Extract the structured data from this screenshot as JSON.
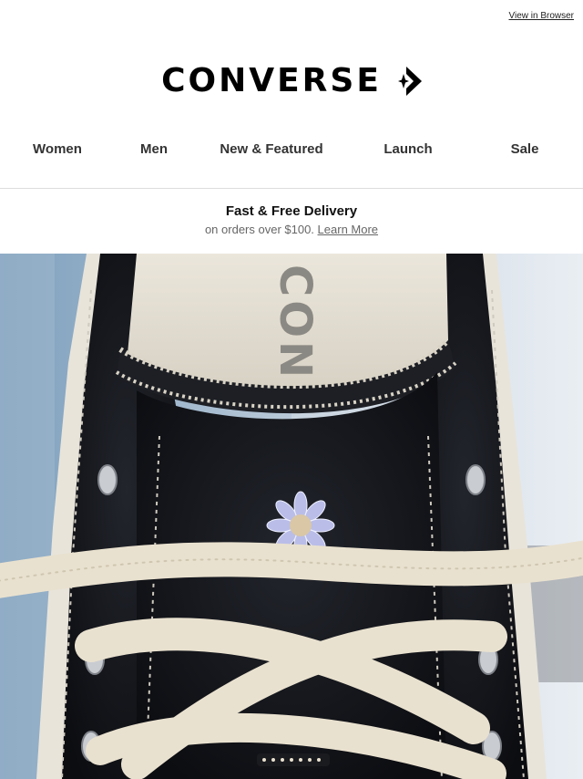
{
  "header": {
    "view_in_browser": "View in Browser"
  },
  "brand": {
    "logo_text": "CONVERSE",
    "logo_icon": "star-chevron-icon"
  },
  "nav": {
    "items": [
      {
        "label": "Women"
      },
      {
        "label": "Men"
      },
      {
        "label": "New & Featured"
      },
      {
        "label": "Launch"
      },
      {
        "label": "Sale"
      }
    ]
  },
  "promo": {
    "title": "Fast & Free Delivery",
    "subtitle": "on orders over $100.",
    "link": "Learn More"
  },
  "hero": {
    "image": "black canvas sneaker with embroidered daisy and cream laces",
    "insole_text": "CON"
  },
  "colors": {
    "text": "#111111",
    "muted": "#666666",
    "divider": "#dddddd",
    "canvas_black": "#15171c",
    "lace_cream": "#e9e1cf"
  }
}
